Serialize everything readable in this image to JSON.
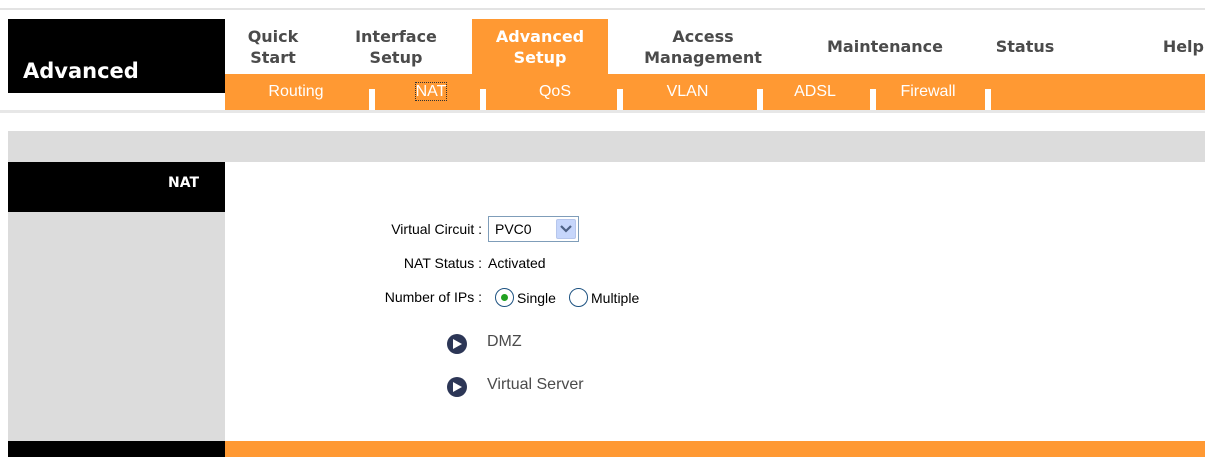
{
  "header": {
    "section_label": "Advanced",
    "tabs": [
      {
        "line1": "Quick",
        "line2": "Start"
      },
      {
        "line1": "Interface",
        "line2": "Setup"
      },
      {
        "line1": "Advanced",
        "line2": "Setup"
      },
      {
        "line1": "Access",
        "line2": "Management"
      },
      {
        "line1": "Maintenance",
        "line2": ""
      },
      {
        "line1": "Status",
        "line2": ""
      },
      {
        "line1": "Help",
        "line2": ""
      }
    ],
    "subtabs": [
      "Routing",
      "NAT",
      "QoS",
      "VLAN",
      "ADSL",
      "Firewall"
    ]
  },
  "section": {
    "title": "NAT"
  },
  "form": {
    "virtual_circuit_label": "Virtual Circuit :",
    "virtual_circuit_value": "PVC0",
    "nat_status_label": "NAT Status :",
    "nat_status_value": "Activated",
    "number_of_ips_label": "Number of IPs :",
    "single_label": "Single",
    "multiple_label": "Multiple",
    "selected_ip_mode": "Single"
  },
  "links": {
    "dmz": "DMZ",
    "virtual_server": "Virtual Server"
  },
  "colors": {
    "accent": "#ff9933",
    "black": "#000000",
    "panel_gray": "#dcdcdc"
  }
}
